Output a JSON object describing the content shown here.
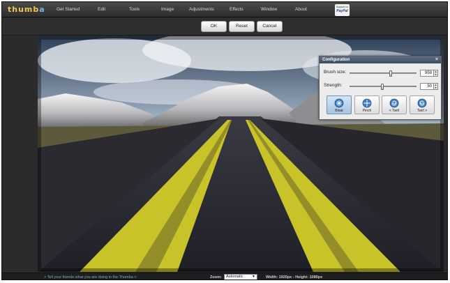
{
  "app": {
    "logo_part1": "thumb",
    "logo_part2": "a"
  },
  "menu": [
    {
      "label": "Get Started"
    },
    {
      "label": "Edit"
    },
    {
      "label": "Tools"
    },
    {
      "label": "Image"
    },
    {
      "label": "Adjustments"
    },
    {
      "label": "Effects"
    },
    {
      "label": "Window"
    },
    {
      "label": "About"
    }
  ],
  "paypal": {
    "caption": "Support us",
    "logo": "PayPal"
  },
  "actions": {
    "ok": "OK",
    "reset": "Reset",
    "cancel": "Cancel"
  },
  "config": {
    "title": "Configuration",
    "close": "×",
    "brush_size": {
      "label": "Brush size:",
      "value": "959",
      "fraction": 0.63
    },
    "strength": {
      "label": "Strength:",
      "value": "50",
      "fraction": 0.5
    },
    "tools": [
      {
        "label": "Bloat",
        "icon": "bloat-icon",
        "active": true
      },
      {
        "label": "Pinch",
        "icon": "pinch-icon",
        "active": false
      },
      {
        "label": "< Twirl",
        "icon": "twirl-left-icon",
        "active": false
      },
      {
        "label": "Twirl >",
        "icon": "twirl-right-icon",
        "active": false
      }
    ]
  },
  "status": {
    "tell": "> Tell your friends what you are doing in the Thumba <",
    "zoom_label": "Zoom:",
    "zoom_value": "Automatic",
    "dimensions": "Width: 1920px - Height: 1080px"
  },
  "colors": {
    "logo_yellow": "#f2c84b",
    "logo_blue": "#6fb6e8",
    "config_title": "#3c4b5f",
    "road_line": "#c9c32a"
  }
}
